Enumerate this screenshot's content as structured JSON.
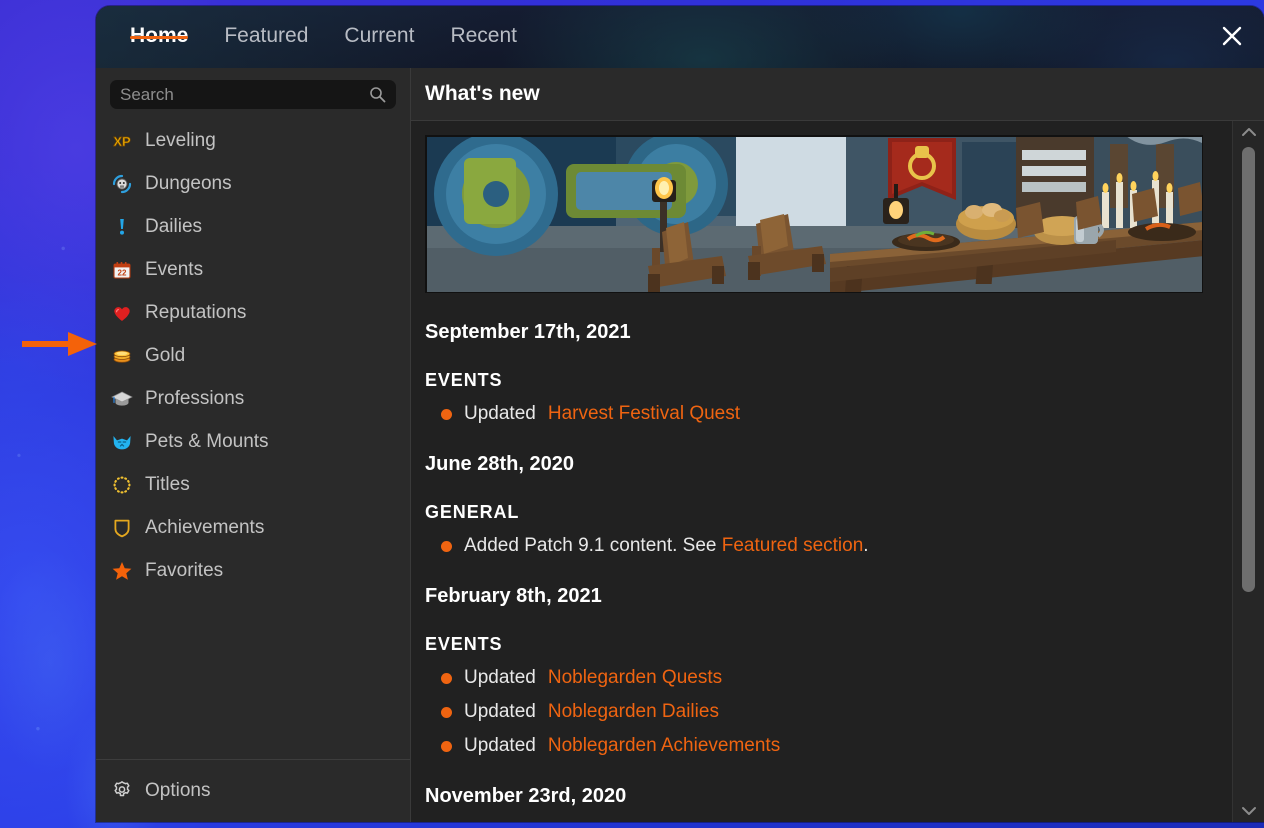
{
  "window": {
    "close_icon": "close-x-icon",
    "tabs": [
      {
        "label": "Home",
        "active": true
      },
      {
        "label": "Featured",
        "active": false
      },
      {
        "label": "Current",
        "active": false
      },
      {
        "label": "Recent",
        "active": false
      }
    ],
    "accent_color": "#ef6411",
    "header_bg": "#141b2e",
    "sidebar_bg": "#2a2a2a",
    "content_bg": "#212121"
  },
  "sidebar": {
    "search": {
      "placeholder": "Search",
      "value": "",
      "icon": "search-icon"
    },
    "items": [
      {
        "label": "Leveling",
        "icon": "xp-icon"
      },
      {
        "label": "Dungeons",
        "icon": "dungeon-portal-icon"
      },
      {
        "label": "Dailies",
        "icon": "exclamation-mark-icon"
      },
      {
        "label": "Events",
        "icon": "calendar-icon"
      },
      {
        "label": "Reputations",
        "icon": "heart-icon"
      },
      {
        "label": "Gold",
        "icon": "gold-coins-icon"
      },
      {
        "label": "Professions",
        "icon": "graduation-cap-icon"
      },
      {
        "label": "Pets & Mounts",
        "icon": "cat-head-icon"
      },
      {
        "label": "Titles",
        "icon": "laurel-wreath-icon"
      },
      {
        "label": "Achievements",
        "icon": "shield-icon"
      },
      {
        "label": "Favorites",
        "icon": "star-icon"
      }
    ],
    "options": {
      "label": "Options",
      "icon": "gear-icon"
    }
  },
  "content": {
    "title": "What's new",
    "banner_alt": "harvest-festival-feast-banner",
    "entries": [
      {
        "date": "September 17th, 2021",
        "category": "EVENTS",
        "lines": [
          {
            "prefix": "Updated",
            "link": "Harvest Festival Quest",
            "suffix": ""
          }
        ]
      },
      {
        "date": "June 28th, 2020",
        "category": "GENERAL",
        "lines": [
          {
            "prefix": "Added Patch 9.1 content. See",
            "link": "Featured section",
            "suffix": "."
          }
        ]
      },
      {
        "date": "February 8th, 2021",
        "category": "EVENTS",
        "lines": [
          {
            "prefix": "Updated",
            "link": "Noblegarden Quests",
            "suffix": ""
          },
          {
            "prefix": "Updated",
            "link": "Noblegarden Dailies",
            "suffix": ""
          },
          {
            "prefix": "Updated",
            "link": "Noblegarden Achievements",
            "suffix": ""
          }
        ]
      },
      {
        "date": "November 23rd, 2020",
        "category": "",
        "lines": []
      }
    ],
    "scrollbar": {
      "up_icon": "chevron-up-icon",
      "down_icon": "chevron-down-icon"
    }
  },
  "annotation": {
    "arrow": "right-arrow-annotation",
    "color": "#f4620a",
    "points_at": "Gold"
  }
}
